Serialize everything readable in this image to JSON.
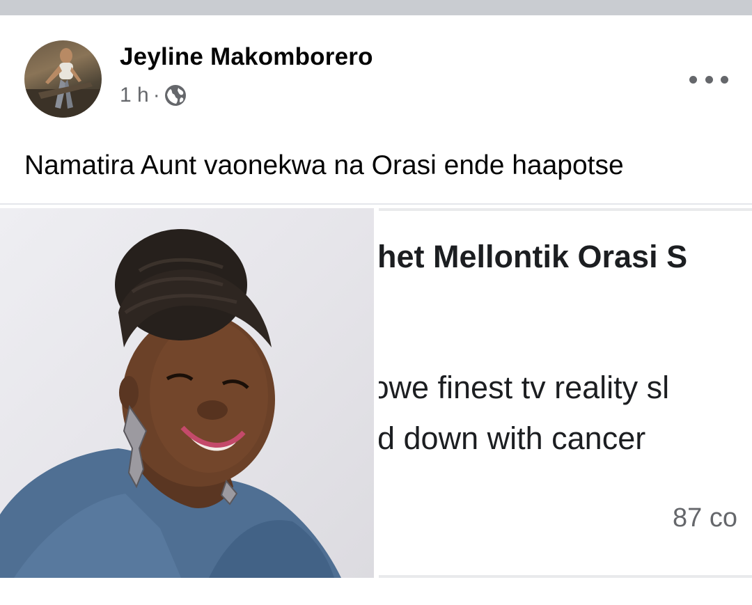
{
  "post": {
    "author": "Jeyline Makomborero",
    "time": "1 h",
    "separator": "·",
    "privacy_icon": "globe-icon",
    "more_icon": "ellipsis-icon",
    "text": "Namatira Aunt vaonekwa na Orasi ende haapotse"
  },
  "screenshot_image": {
    "title": "het Mellontik Orasi S",
    "line1": "ɔwe finest tv reality sl",
    "line2": "d down with cancer",
    "count": "87 co"
  },
  "colors": {
    "top_band": "#c9ccd1",
    "text_primary": "#050505",
    "text_secondary": "#65676b",
    "divider": "#e4e6eb"
  }
}
